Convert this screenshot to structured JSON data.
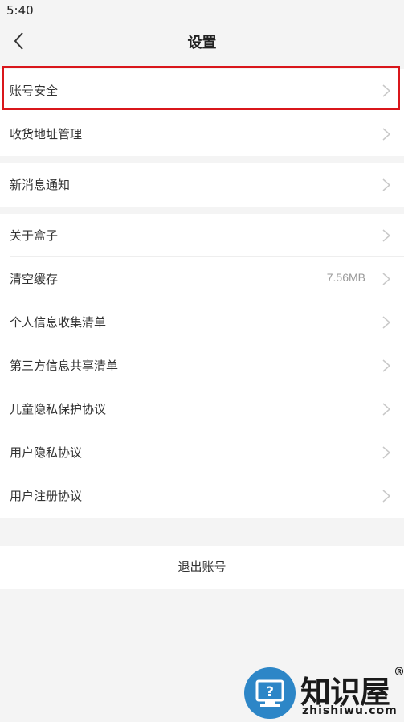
{
  "status_bar": {
    "time": "5:40"
  },
  "header": {
    "title": "设置",
    "back_icon": "chevron-left-icon"
  },
  "group1": [
    {
      "label": "账号安全",
      "highlighted": true
    },
    {
      "label": "收货地址管理"
    }
  ],
  "group2": [
    {
      "label": "新消息通知"
    }
  ],
  "group3": [
    {
      "label": "关于盒子"
    },
    {
      "label": "清空缓存",
      "value": "7.56MB"
    },
    {
      "label": "个人信息收集清单"
    },
    {
      "label": "第三方信息共享清单"
    },
    {
      "label": "儿童隐私保护协议"
    },
    {
      "label": "用户隐私协议"
    },
    {
      "label": "用户注册协议"
    }
  ],
  "logout_label": "退出账号",
  "watermark": {
    "title": "知识屋",
    "reg": "®",
    "domain": "zhishiwu.com"
  },
  "colors": {
    "highlight": "#d9161b",
    "watermark_blue": "#2d86c7",
    "background": "#f4f4f4"
  }
}
